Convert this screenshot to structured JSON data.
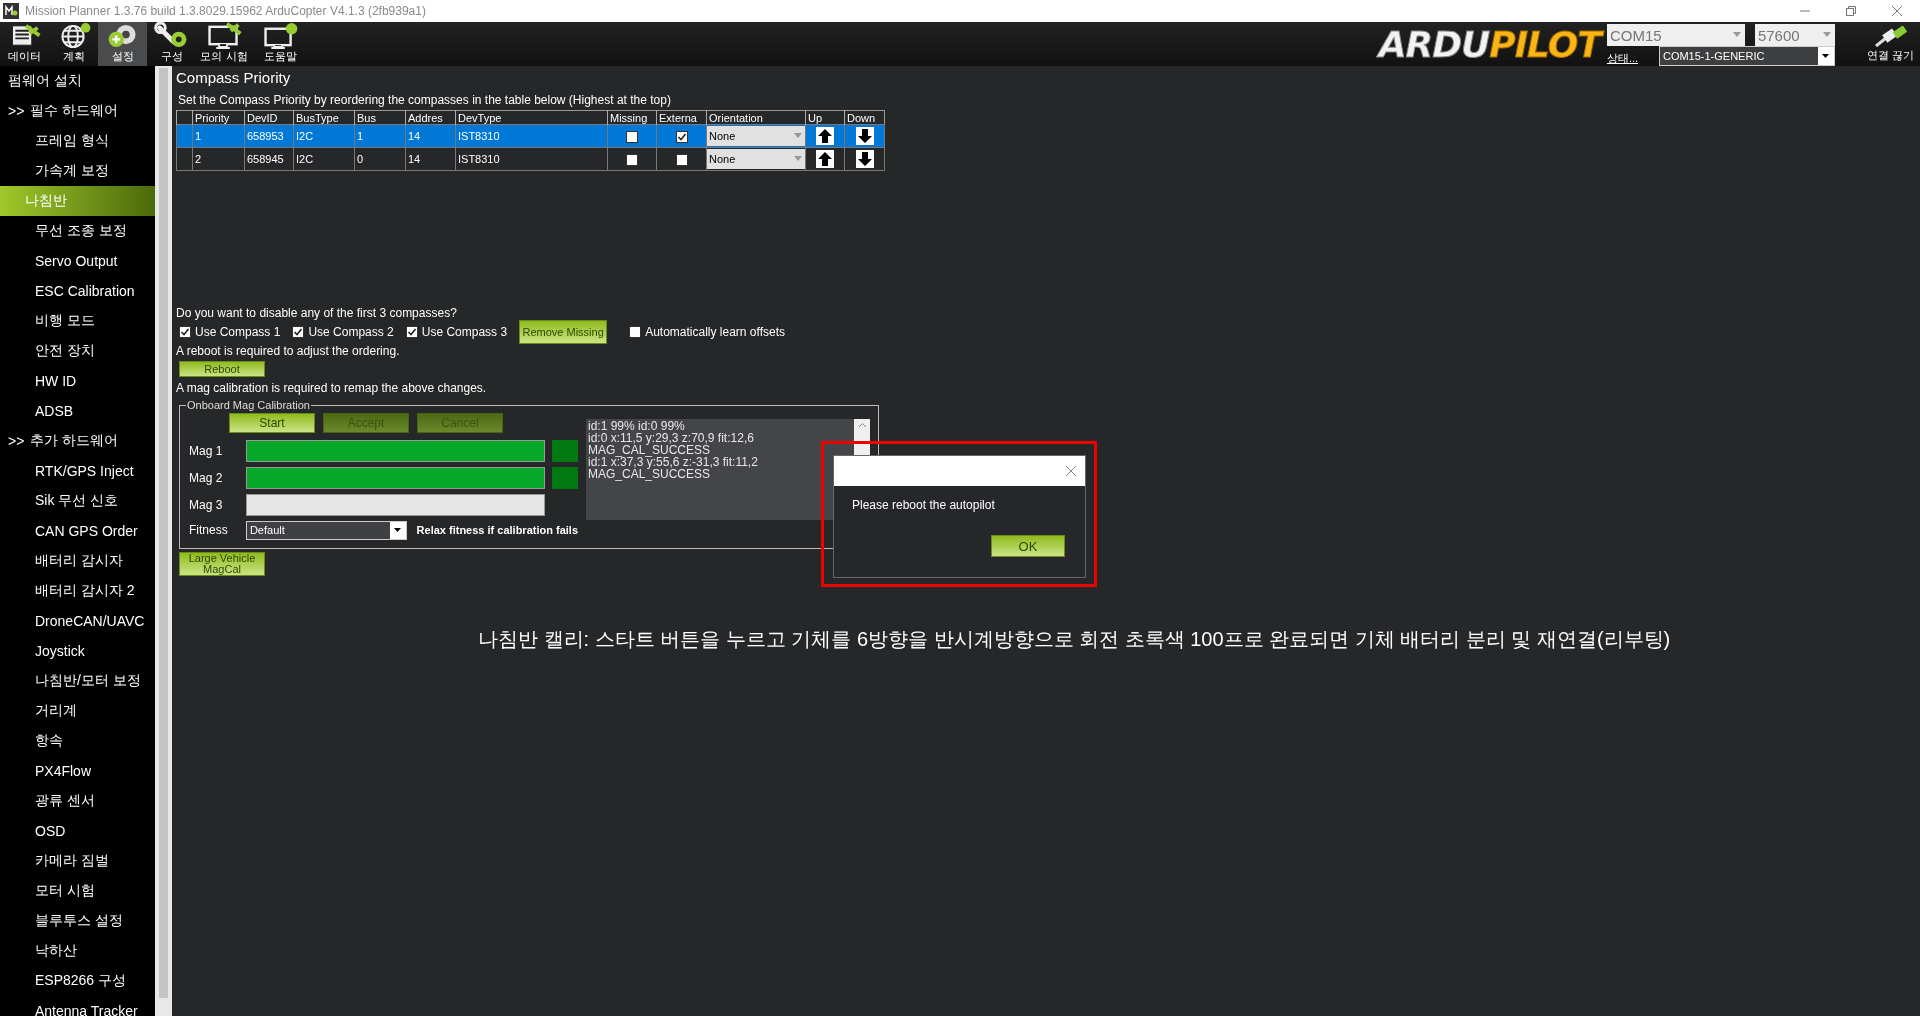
{
  "window": {
    "title": "Mission Planner 1.3.76 build 1.3.8029.15962 ArduCopter V4.1.3 (2fb939a1)"
  },
  "toolbar": {
    "items": [
      {
        "label": "데이터",
        "selected": false
      },
      {
        "label": "계획",
        "selected": false
      },
      {
        "label": "설정",
        "selected": true
      },
      {
        "label": "구성",
        "selected": false
      },
      {
        "label": "모의 시험",
        "selected": false
      },
      {
        "label": "도움말",
        "selected": false
      }
    ],
    "logo": {
      "left": "ARDU",
      "right": "PILOT"
    },
    "port": "COM15",
    "baud": "57600",
    "status_link": "상태...",
    "device": "COM15-1-GENERIC",
    "disconnect": "연결 끊기"
  },
  "sidebar": {
    "items": [
      {
        "label": "펌웨어 설치",
        "selected": false
      },
      {
        "marker": ">>",
        "label": "필수 하드웨어",
        "selected": false,
        "children": [
          {
            "label": "프레임 형식",
            "selected": false
          },
          {
            "label": "가속계 보정",
            "selected": false
          },
          {
            "label": "나침반",
            "selected": true
          },
          {
            "label": "무선 조종 보정",
            "selected": false
          },
          {
            "label": "Servo Output",
            "selected": false
          },
          {
            "label": "ESC Calibration",
            "selected": false
          },
          {
            "label": "비행 모드",
            "selected": false
          },
          {
            "label": "안전 장치",
            "selected": false
          },
          {
            "label": "HW ID",
            "selected": false
          },
          {
            "label": "ADSB",
            "selected": false
          }
        ]
      },
      {
        "marker": ">>",
        "label": "추가 하드웨어",
        "selected": false,
        "children": [
          {
            "label": "RTK/GPS Inject",
            "selected": false
          },
          {
            "label": "Sik 무선 신호",
            "selected": false
          },
          {
            "label": "CAN GPS Order",
            "selected": false
          },
          {
            "label": "배터리 감시자",
            "selected": false
          },
          {
            "label": "배터리 감시자 2",
            "selected": false
          },
          {
            "label": "DroneCAN/UAVC",
            "selected": false
          },
          {
            "label": "Joystick",
            "selected": false
          },
          {
            "label": "나침반/모터 보정",
            "selected": false
          },
          {
            "label": "거리계",
            "selected": false
          },
          {
            "label": "항속",
            "selected": false
          },
          {
            "label": "PX4Flow",
            "selected": false
          },
          {
            "label": "광류 센서",
            "selected": false
          },
          {
            "label": "OSD",
            "selected": false
          },
          {
            "label": "카메라 짐벌",
            "selected": false
          },
          {
            "label": "모터 시험",
            "selected": false
          },
          {
            "label": "블루투스 설정",
            "selected": false
          },
          {
            "label": "낙하산",
            "selected": false
          },
          {
            "label": "ESP8266 구성",
            "selected": false
          },
          {
            "label": "Antenna Tracker",
            "selected": false
          }
        ]
      }
    ]
  },
  "page": {
    "title": "Compass Priority",
    "description": "Set the Compass Priority by reordering the compasses in the table below (Highest at the top)",
    "table": {
      "columns": [
        "Priority",
        "DevID",
        "BusType",
        "Bus",
        "Addres",
        "DevType",
        "Missing",
        "Externa",
        "Orientation",
        "Up",
        "Down"
      ],
      "rows": [
        {
          "priority": "1",
          "devid": "658953",
          "bus_type": "I2C",
          "bus": "1",
          "address": "14",
          "dev_type": "IST8310",
          "missing": false,
          "external": true,
          "orientation": "None",
          "selected": true
        },
        {
          "priority": "2",
          "devid": "658945",
          "bus_type": "I2C",
          "bus": "0",
          "address": "14",
          "dev_type": "IST8310",
          "missing": false,
          "external": false,
          "orientation": "None",
          "selected": false
        }
      ]
    },
    "question": "Do you want to disable any of the first 3 compasses?",
    "compasses": [
      {
        "label": "Use Compass 1",
        "checked": true
      },
      {
        "label": "Use Compass 2",
        "checked": true
      },
      {
        "label": "Use Compass 3",
        "checked": true
      }
    ],
    "remove_missing": "Remove Missing",
    "auto_learn": {
      "label": "Automatically learn offsets",
      "checked": false
    },
    "reboot_note": "A reboot is required to adjust the ordering.",
    "reboot_button": "Reboot",
    "remap_note": "A mag calibration is required to remap the above changes.",
    "calibration": {
      "title": "Onboard Mag Calibration",
      "buttons": [
        {
          "label": "Start",
          "disabled": false
        },
        {
          "label": "Accept",
          "disabled": true
        },
        {
          "label": "Cancel",
          "disabled": true
        }
      ],
      "mags": [
        {
          "label": "Mag 1",
          "level": 1,
          "done": true
        },
        {
          "label": "Mag 2",
          "level": 1,
          "done": true
        },
        {
          "label": "Mag 3",
          "level": 0,
          "done": false
        }
      ],
      "fitness_label": "Fitness",
      "fitness": "Default",
      "relax": "Relax fitness if calibration fails",
      "log": [
        "id:1 99% id:0 99%",
        "id:0 x:11,5 y:29,3 z:70,9 fit:12,6",
        "MAG_CAL_SUCCESS",
        "id:1 x:37,3 y:55,6 z:-31,3 fit:11,2",
        "MAG_CAL_SUCCESS"
      ]
    },
    "large_vehicle": "Large Vehicle MagCal",
    "caption": "나침반 캘리: 스타트 버튼을 누르고 기체를 6방향을 반시계방향으로 회전 초록색 100프로 완료되면 기체 배터리 분리 및 재연결(리부팅)"
  },
  "dialog": {
    "message": "Please reboot the autopilot",
    "ok": "OK"
  }
}
